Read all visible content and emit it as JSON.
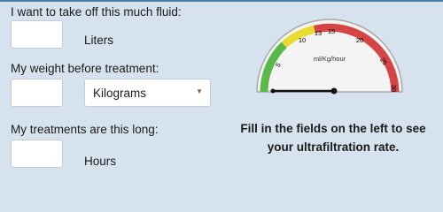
{
  "form": {
    "fluid_label": "I want to take off this much fluid:",
    "fluid_value": "",
    "fluid_unit": "Liters",
    "weight_label": "My weight before treatment:",
    "weight_value": "",
    "weight_unit_selected": "Kilograms",
    "duration_label": "My treatments are this long:",
    "duration_value": "",
    "duration_unit": "Hours"
  },
  "gauge": {
    "unit_label": "ml/Kg/hour",
    "ticks": [
      "5",
      "10",
      "13",
      "15",
      "20",
      "25",
      "30"
    ],
    "zone_colors": [
      "#5bb94a",
      "#e8dc2e",
      "#d64545"
    ]
  },
  "message": "Fill in the fields on the left to see your ultrafiltration rate."
}
